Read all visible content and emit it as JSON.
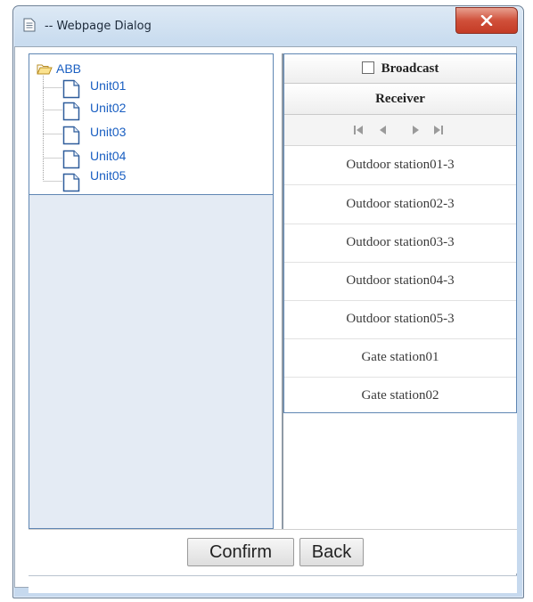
{
  "window": {
    "title": "-- Webpage Dialog"
  },
  "tree": {
    "root": "ABB",
    "items": [
      "Unit01",
      "Unit02",
      "Unit03",
      "Unit04",
      "Unit05"
    ]
  },
  "receiver_panel": {
    "broadcast_label": "Broadcast",
    "broadcast_checked": false,
    "receiver_header": "Receiver",
    "rows": [
      "Outdoor station01-3",
      "Outdoor station02-3",
      "Outdoor station03-3",
      "Outdoor station04-3",
      "Outdoor station05-3",
      "Gate station01",
      "Gate station02"
    ]
  },
  "footer": {
    "confirm_label": "Confirm",
    "back_label": "Back"
  },
  "colors": {
    "tree_text": "#1a5fc2",
    "panel_border": "#5f86b3",
    "close_red": "#c43b25"
  }
}
